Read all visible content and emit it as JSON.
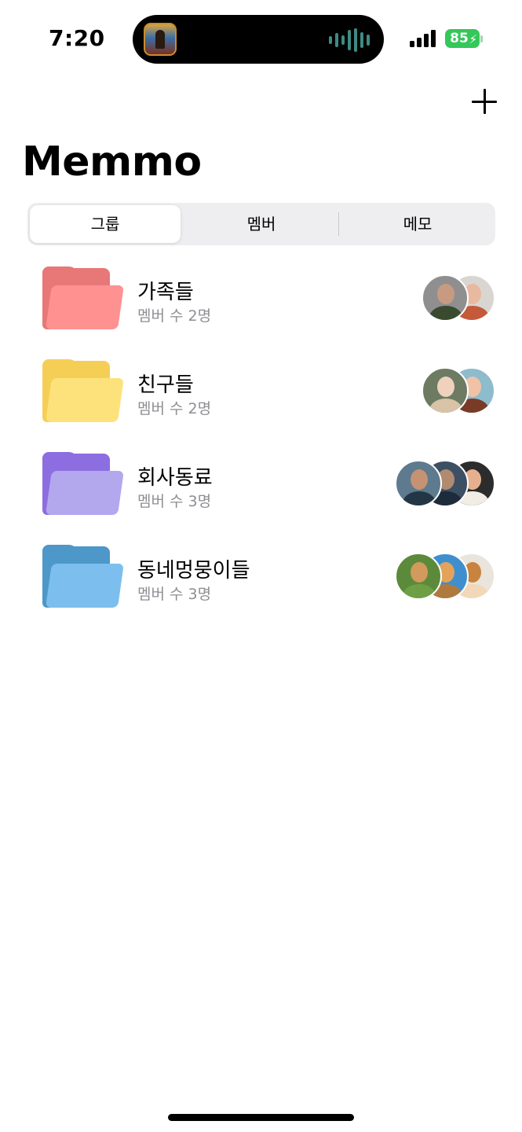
{
  "status_bar": {
    "time": "7:20",
    "battery": "85",
    "icons": [
      "now-playing-artwork",
      "audio-waveform-icon",
      "cellular-signal-icon",
      "battery-icon"
    ]
  },
  "header": {
    "title": "Memmo",
    "add_icon": "plus-icon"
  },
  "segments": [
    {
      "label": "그룹",
      "selected": true
    },
    {
      "label": "멤버",
      "selected": false
    },
    {
      "label": "메모",
      "selected": false
    }
  ],
  "groups": [
    {
      "name": "가족들",
      "count": "멤버 수 2명",
      "icon": "folder-icon",
      "color_back": "#e87777",
      "color_front": "#ff9191",
      "avatars": [
        {
          "bg": "#8f8f8f",
          "head": "#c99a82",
          "body": "#3a4a2f"
        },
        {
          "bg": "#d9d6d2",
          "head": "#e8b9a0",
          "body": "#c45a3a"
        }
      ]
    },
    {
      "name": "친구들",
      "count": "멤버 수 2명",
      "icon": "folder-icon",
      "color_back": "#f5cf55",
      "color_front": "#fde27c",
      "avatars": [
        {
          "bg": "#6d7b63",
          "head": "#efd1bd",
          "body": "#d8c3a6"
        },
        {
          "bg": "#8dbccc",
          "head": "#f0c3a8",
          "body": "#7a3b26"
        }
      ]
    },
    {
      "name": "회사동료",
      "count": "멤버 수 3명",
      "icon": "folder-icon",
      "color_back": "#8d6ee0",
      "color_front": "#b3a7ee",
      "avatars": [
        {
          "bg": "#5e7a8e",
          "head": "#c59274",
          "body": "#233645"
        },
        {
          "bg": "#3d4f63",
          "head": "#b08b70",
          "body": "#1d2b3a"
        },
        {
          "bg": "#2c2c2c",
          "head": "#e6b08f",
          "body": "#f1ece4"
        }
      ]
    },
    {
      "name": "동네멍뭉이들",
      "count": "멤버 수 3명",
      "icon": "folder-icon",
      "color_back": "#4d97c9",
      "color_front": "#7cbfee",
      "avatars": [
        {
          "bg": "#5c8a3b",
          "head": "#d29a5c",
          "body": "#6f9f45"
        },
        {
          "bg": "#3f8fcf",
          "head": "#e3a35b",
          "body": "#b07a3e"
        },
        {
          "bg": "#e9e4dc",
          "head": "#c8833e",
          "body": "#f2d8b8"
        }
      ]
    }
  ]
}
